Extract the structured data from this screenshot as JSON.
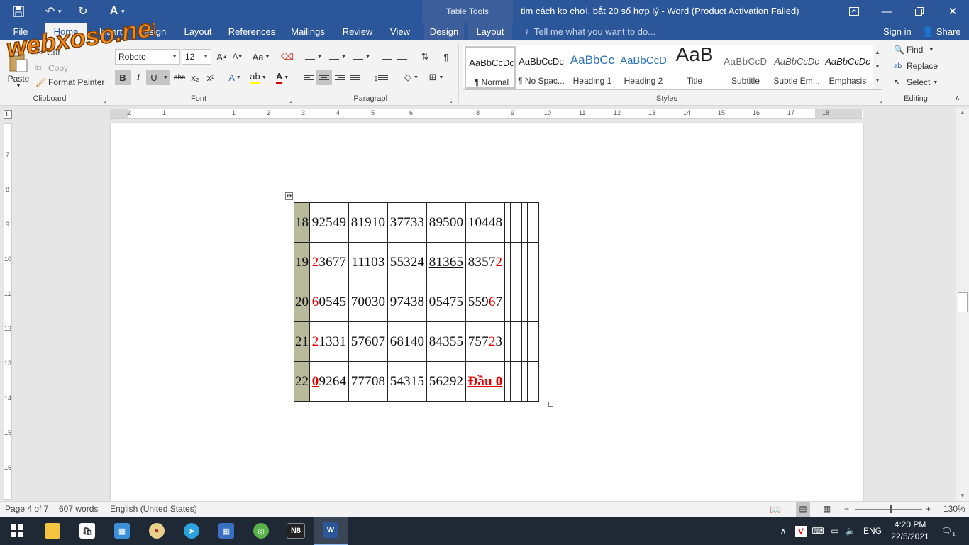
{
  "window": {
    "title": "tim cách ko chơi. bắt 20 số hợp lý - Word (Product Activation Failed)",
    "context_tab_group": "Table Tools"
  },
  "tabs": [
    {
      "label": "File"
    },
    {
      "label": "Home"
    },
    {
      "label": "Insert"
    },
    {
      "label": "Design"
    },
    {
      "label": "Layout"
    },
    {
      "label": "References"
    },
    {
      "label": "Mailings"
    },
    {
      "label": "Review"
    },
    {
      "label": "View"
    },
    {
      "label": "Design"
    },
    {
      "label": "Layout"
    }
  ],
  "tell_me_placeholder": "Tell me what you want to do...",
  "account": {
    "sign_in": "Sign in",
    "share": "Share"
  },
  "clipboard": {
    "paste": "Paste",
    "cut": "Cut",
    "copy": "Copy",
    "format_painter": "Format Painter",
    "group_label": "Clipboard"
  },
  "font": {
    "family": "Roboto",
    "size": "12",
    "bold": "B",
    "italic": "I",
    "underline": "U",
    "strikethrough": "abc",
    "subscript": "x₂",
    "superscript": "x²",
    "group_label": "Font"
  },
  "paragraph": {
    "group_label": "Paragraph"
  },
  "styles": {
    "items": [
      {
        "sample": "AaBbCcDc",
        "name": "¶ Normal"
      },
      {
        "sample": "AaBbCcDc",
        "name": "¶ No Spac..."
      },
      {
        "sample": "AaBbCc",
        "name": "Heading 1"
      },
      {
        "sample": "AaBbCcD",
        "name": "Heading 2"
      },
      {
        "sample": "AaB",
        "name": "Title"
      },
      {
        "sample": "AaBbCcD",
        "name": "Subtitle"
      },
      {
        "sample": "AaBbCcDc",
        "name": "Subtle Em..."
      },
      {
        "sample": "AaBbCcDc",
        "name": "Emphasis"
      }
    ],
    "group_label": "Styles"
  },
  "editing": {
    "find": "Find",
    "replace": "Replace",
    "select": "Select",
    "group_label": "Editing"
  },
  "ruler_h": [
    "2",
    "1",
    "1",
    "2",
    "3",
    "4",
    "5",
    "6",
    "8",
    "9",
    "10",
    "11",
    "12",
    "13",
    "14",
    "15",
    "16",
    "17",
    "18"
  ],
  "ruler_v": [
    "7",
    "8",
    "9",
    "10",
    "11",
    "12",
    "13",
    "14",
    "15",
    "16"
  ],
  "table": {
    "rows": [
      {
        "day": "18",
        "cells": [
          [
            {
              "t": "92549"
            }
          ],
          [
            {
              "t": "81910"
            }
          ],
          [
            {
              "t": "37733"
            }
          ],
          [
            {
              "t": "89500"
            }
          ],
          [
            {
              "t": "10448"
            }
          ]
        ]
      },
      {
        "day": "19",
        "cells": [
          [
            {
              "t": "2",
              "c": "red"
            },
            {
              "t": "3677"
            }
          ],
          [
            {
              "t": "11103"
            }
          ],
          [
            {
              "t": "55324"
            }
          ],
          [
            {
              "t": "81365",
              "c": "und"
            }
          ],
          [
            {
              "t": "8357"
            },
            {
              "t": "2",
              "c": "red"
            }
          ]
        ]
      },
      {
        "day": "20",
        "cells": [
          [
            {
              "t": "6",
              "c": "red"
            },
            {
              "t": "0545"
            }
          ],
          [
            {
              "t": "70030"
            }
          ],
          [
            {
              "t": "97438"
            }
          ],
          [
            {
              "t": "05475"
            }
          ],
          [
            {
              "t": "559"
            },
            {
              "t": "6",
              "c": "red"
            },
            {
              "t": "7"
            }
          ]
        ]
      },
      {
        "day": "21",
        "cells": [
          [
            {
              "t": "2",
              "c": "red"
            },
            {
              "t": "1331"
            }
          ],
          [
            {
              "t": "57607"
            }
          ],
          [
            {
              "t": "68140"
            }
          ],
          [
            {
              "t": "84355"
            }
          ],
          [
            {
              "t": "757"
            },
            {
              "t": "2",
              "c": "red"
            },
            {
              "t": "3"
            }
          ]
        ]
      },
      {
        "day": "22",
        "cells": [
          [
            {
              "t": "0",
              "c": "red und bold"
            },
            {
              "t": "9264"
            }
          ],
          [
            {
              "t": "77708"
            }
          ],
          [
            {
              "t": "54315"
            }
          ],
          [
            {
              "t": "56292"
            }
          ],
          [
            {
              "t": "Đầu 0",
              "c": "red und bold"
            }
          ]
        ]
      }
    ]
  },
  "status": {
    "page": "Page 4 of 7",
    "words": "607 words",
    "language": "English (United States)",
    "zoom": "130%",
    "zoom_level": 1.3
  },
  "taskbar": {
    "apps": [
      "start",
      "file-explorer",
      "store",
      "control-panel",
      "paint",
      "telegram",
      "calculator",
      "coccoc",
      "n8",
      "word"
    ],
    "tray": {
      "language": "ENG",
      "time": "4:20 PM",
      "date": "22/5/2021",
      "notifications": "1"
    }
  },
  "watermark_text": "webxoso.net",
  "colors": {
    "word_blue": "#2b579a",
    "red_text": "#e00000",
    "day_cell": "#b9b99c"
  }
}
